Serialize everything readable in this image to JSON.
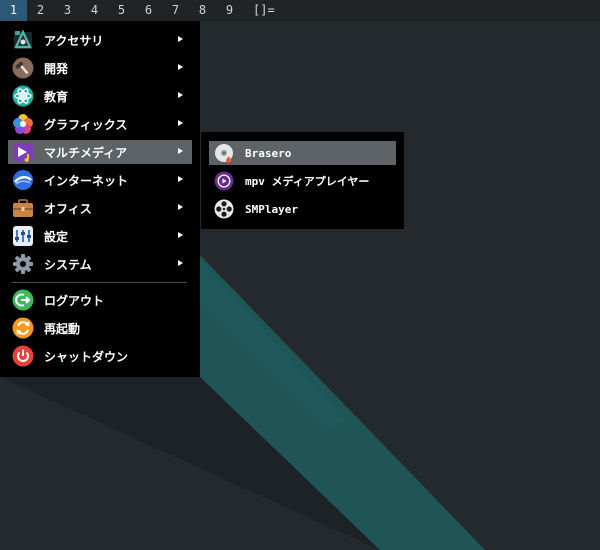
{
  "workspaces": {
    "items": [
      "1",
      "2",
      "3",
      "4",
      "5",
      "6",
      "7",
      "8",
      "9"
    ],
    "active": "1",
    "layout_symbol": "[]="
  },
  "menu": {
    "items": [
      {
        "label": "アクセサリ",
        "icon": "accessories-icon"
      },
      {
        "label": "開発",
        "icon": "development-icon"
      },
      {
        "label": "教育",
        "icon": "education-icon"
      },
      {
        "label": "グラフィックス",
        "icon": "graphics-icon"
      },
      {
        "label": "マルチメディア",
        "icon": "multimedia-icon"
      },
      {
        "label": "インターネット",
        "icon": "internet-icon"
      },
      {
        "label": "オフィス",
        "icon": "office-icon"
      },
      {
        "label": "設定",
        "icon": "settings-icon"
      },
      {
        "label": "システム",
        "icon": "system-icon"
      }
    ],
    "actions": [
      {
        "label": "ログアウト",
        "icon": "logout-icon"
      },
      {
        "label": "再起動",
        "icon": "reboot-icon"
      },
      {
        "label": "シャットダウン",
        "icon": "shutdown-icon"
      }
    ]
  },
  "submenu": {
    "items": [
      {
        "label": "Brasero",
        "icon": "brasero-icon"
      },
      {
        "label": "mpv メディアプレイヤー",
        "icon": "mpv-icon"
      },
      {
        "label": "SMPlayer",
        "icon": "smplayer-icon"
      }
    ]
  },
  "colors": {
    "desktop": "#23292d",
    "wallpaper_stripe": "#1f5557",
    "menu_bg": "#000000",
    "highlight": "#5d6366",
    "active_workspace": "#2d5876"
  }
}
